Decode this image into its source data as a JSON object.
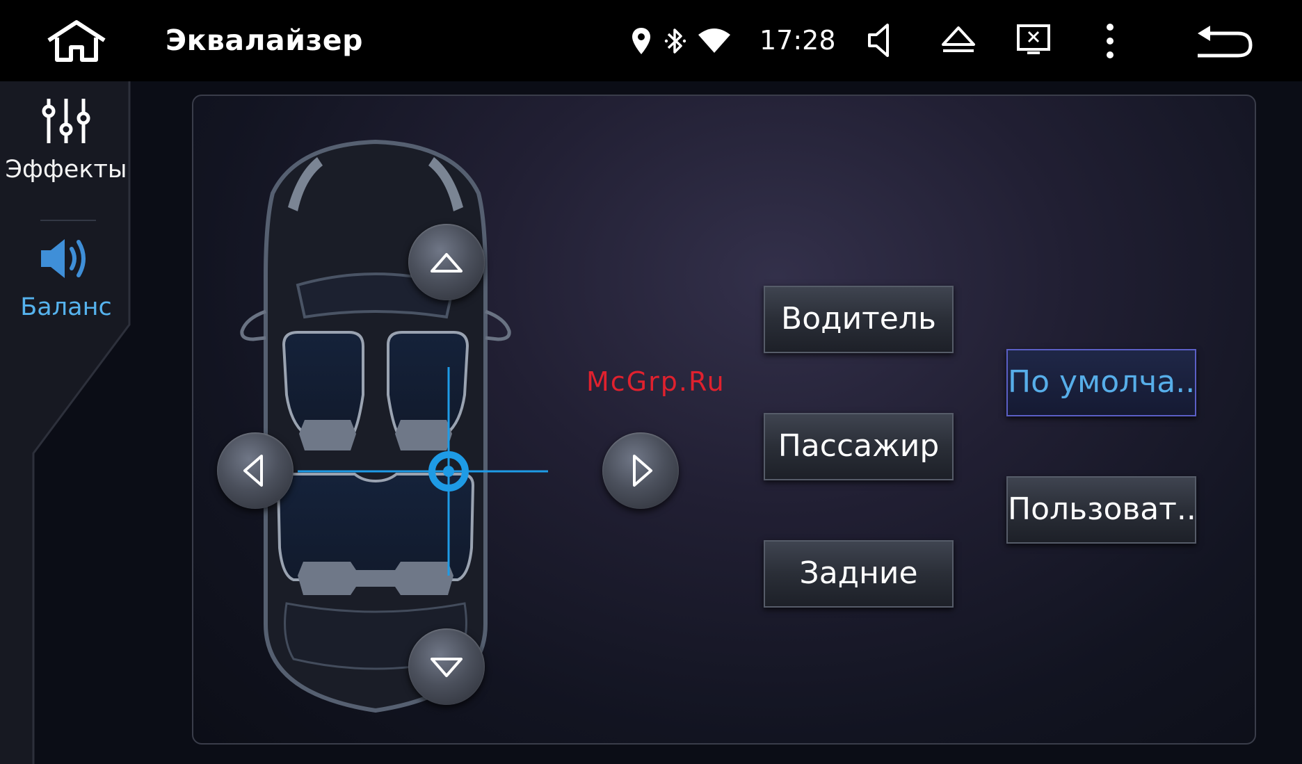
{
  "header": {
    "title": "Эквалайзер",
    "time": "17:28"
  },
  "sidebar": {
    "items": [
      {
        "label": "Эффекты",
        "icon": "sliders-icon",
        "active": false
      },
      {
        "label": "Баланс",
        "icon": "speaker-icon",
        "active": true
      }
    ],
    "active_color": "#56b3ee"
  },
  "presets": {
    "driver": "Водитель",
    "passenger": "Пассажир",
    "rear": "Задние",
    "default": "По умолча...",
    "custom": "Пользоват..."
  },
  "selected_preset": "default",
  "watermark": "McGrp.Ru",
  "colors": {
    "accent": "#1e9be6",
    "selected_border": "#5b5fc6"
  }
}
